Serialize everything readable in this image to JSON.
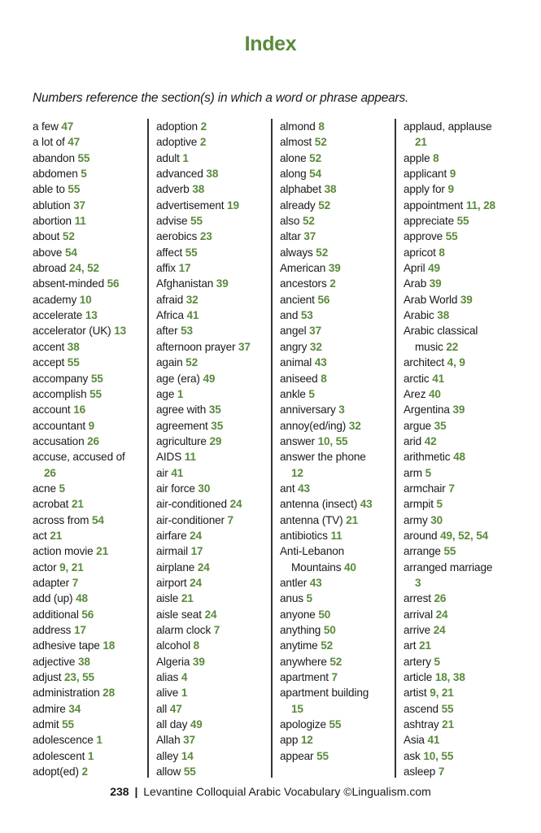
{
  "page": {
    "title": "Index",
    "subtitle": "Numbers reference the section(s) in which a word or phrase appears.",
    "footer": {
      "page_number": "238",
      "separator": "|",
      "text": "Levantine Colloquial Arabic Vocabulary ©Lingualism.com"
    },
    "accent_color": "#5a8a3c"
  },
  "columns": [
    [
      {
        "term": "a few",
        "refs": "47"
      },
      {
        "term": "a lot of",
        "refs": "47"
      },
      {
        "term": "abandon",
        "refs": "55"
      },
      {
        "term": "abdomen",
        "refs": "5"
      },
      {
        "term": "able to",
        "refs": "55"
      },
      {
        "term": "ablution",
        "refs": "37"
      },
      {
        "term": "abortion",
        "refs": "11"
      },
      {
        "term": "about",
        "refs": "52"
      },
      {
        "term": "above",
        "refs": "54"
      },
      {
        "term": "abroad",
        "refs": "24, 52"
      },
      {
        "term": "absent-minded",
        "refs": "56"
      },
      {
        "term": "academy",
        "refs": "10"
      },
      {
        "term": "accelerate",
        "refs": "13"
      },
      {
        "term": "accelerator (UK)",
        "refs": "13"
      },
      {
        "term": "accent",
        "refs": "38"
      },
      {
        "term": "accept",
        "refs": "55"
      },
      {
        "term": "accompany",
        "refs": "55"
      },
      {
        "term": "accomplish",
        "refs": "55"
      },
      {
        "term": "account",
        "refs": "16"
      },
      {
        "term": "accountant",
        "refs": "9"
      },
      {
        "term": "accusation",
        "refs": "26"
      },
      {
        "term": "accuse, accused of",
        "refs": "26",
        "wrap": true
      },
      {
        "term": "acne",
        "refs": "5"
      },
      {
        "term": "acrobat",
        "refs": "21"
      },
      {
        "term": "across from",
        "refs": "54"
      },
      {
        "term": "act",
        "refs": "21"
      },
      {
        "term": "action movie",
        "refs": "21"
      },
      {
        "term": "actor",
        "refs": "9, 21"
      },
      {
        "term": "adapter",
        "refs": "7"
      },
      {
        "term": "add (up)",
        "refs": "48"
      },
      {
        "term": "additional",
        "refs": "56"
      },
      {
        "term": "address",
        "refs": "17"
      },
      {
        "term": "adhesive tape",
        "refs": "18"
      },
      {
        "term": "adjective",
        "refs": "38"
      },
      {
        "term": "adjust",
        "refs": "23, 55"
      },
      {
        "term": "administration",
        "refs": "28"
      },
      {
        "term": "admire",
        "refs": "34"
      },
      {
        "term": "admit",
        "refs": "55"
      },
      {
        "term": "adolescence",
        "refs": "1"
      },
      {
        "term": "adolescent",
        "refs": "1"
      },
      {
        "term": "adopt(ed)",
        "refs": "2"
      }
    ],
    [
      {
        "term": "adoption",
        "refs": "2"
      },
      {
        "term": "adoptive",
        "refs": "2"
      },
      {
        "term": "adult",
        "refs": "1"
      },
      {
        "term": "advanced",
        "refs": "38"
      },
      {
        "term": "adverb",
        "refs": "38"
      },
      {
        "term": "advertisement",
        "refs": "19"
      },
      {
        "term": "advise",
        "refs": "55"
      },
      {
        "term": "aerobics",
        "refs": "23"
      },
      {
        "term": "affect",
        "refs": "55"
      },
      {
        "term": "affix",
        "refs": "17"
      },
      {
        "term": "Afghanistan",
        "refs": "39"
      },
      {
        "term": "afraid",
        "refs": "32"
      },
      {
        "term": "Africa",
        "refs": "41"
      },
      {
        "term": "after",
        "refs": "53"
      },
      {
        "term": "afternoon prayer",
        "refs": "37"
      },
      {
        "term": "again",
        "refs": "52"
      },
      {
        "term": "age (era)",
        "refs": "49"
      },
      {
        "term": "age",
        "refs": "1"
      },
      {
        "term": "agree with",
        "refs": "35"
      },
      {
        "term": "agreement",
        "refs": "35"
      },
      {
        "term": "agriculture",
        "refs": "29"
      },
      {
        "term": "AIDS",
        "refs": "11"
      },
      {
        "term": "air",
        "refs": "41"
      },
      {
        "term": "air force",
        "refs": "30"
      },
      {
        "term": "air-conditioned",
        "refs": "24"
      },
      {
        "term": "air-conditioner",
        "refs": "7"
      },
      {
        "term": "airfare",
        "refs": "24"
      },
      {
        "term": "airmail",
        "refs": "17"
      },
      {
        "term": "airplane",
        "refs": "24"
      },
      {
        "term": "airport",
        "refs": "24"
      },
      {
        "term": "aisle",
        "refs": "21"
      },
      {
        "term": "aisle seat",
        "refs": "24"
      },
      {
        "term": "alarm clock",
        "refs": "7"
      },
      {
        "term": "alcohol",
        "refs": "8"
      },
      {
        "term": "Algeria",
        "refs": "39"
      },
      {
        "term": "alias",
        "refs": "4"
      },
      {
        "term": "alive",
        "refs": "1"
      },
      {
        "term": "all",
        "refs": "47"
      },
      {
        "term": "all day",
        "refs": "49"
      },
      {
        "term": "Allah",
        "refs": "37"
      },
      {
        "term": "alley",
        "refs": "14"
      },
      {
        "term": "allow",
        "refs": "55"
      }
    ],
    [
      {
        "term": "almond",
        "refs": "8"
      },
      {
        "term": "almost",
        "refs": "52"
      },
      {
        "term": "alone",
        "refs": "52"
      },
      {
        "term": "along",
        "refs": "54"
      },
      {
        "term": "alphabet",
        "refs": "38"
      },
      {
        "term": "already",
        "refs": "52"
      },
      {
        "term": "also",
        "refs": "52"
      },
      {
        "term": "altar",
        "refs": "37"
      },
      {
        "term": "always",
        "refs": "52"
      },
      {
        "term": "American",
        "refs": "39"
      },
      {
        "term": "ancestors",
        "refs": "2"
      },
      {
        "term": "ancient",
        "refs": "56"
      },
      {
        "term": "and",
        "refs": "53"
      },
      {
        "term": "angel",
        "refs": "37"
      },
      {
        "term": "angry",
        "refs": "32"
      },
      {
        "term": "animal",
        "refs": "43"
      },
      {
        "term": "aniseed",
        "refs": "8"
      },
      {
        "term": "ankle",
        "refs": "5"
      },
      {
        "term": "anniversary",
        "refs": "3"
      },
      {
        "term": "annoy(ed/ing)",
        "refs": "32"
      },
      {
        "term": "answer",
        "refs": "10, 55"
      },
      {
        "term": "answer the phone",
        "refs": "12",
        "wrap": true
      },
      {
        "term": "ant",
        "refs": "43"
      },
      {
        "term": "antenna (insect)",
        "refs": "43"
      },
      {
        "term": "antenna (TV)",
        "refs": "21"
      },
      {
        "term": "antibiotics",
        "refs": "11"
      },
      {
        "term": "Anti-Lebanon",
        "term2": "Mountains",
        "refs": "40",
        "wrap": true
      },
      {
        "term": "antler",
        "refs": "43"
      },
      {
        "term": "anus",
        "refs": "5"
      },
      {
        "term": "anyone",
        "refs": "50"
      },
      {
        "term": "anything",
        "refs": "50"
      },
      {
        "term": "anytime",
        "refs": "52"
      },
      {
        "term": "anywhere",
        "refs": "52"
      },
      {
        "term": "apartment",
        "refs": "7"
      },
      {
        "term": "apartment building",
        "refs": "15",
        "wrap": true
      },
      {
        "term": "apologize",
        "refs": "55"
      },
      {
        "term": "app",
        "refs": "12"
      },
      {
        "term": "appear",
        "refs": "55"
      }
    ],
    [
      {
        "term": "applaud, applause",
        "refs": "21",
        "wrap": true
      },
      {
        "term": "apple",
        "refs": "8"
      },
      {
        "term": "applicant",
        "refs": "9"
      },
      {
        "term": "apply for",
        "refs": "9"
      },
      {
        "term": "appointment",
        "refs": "11, 28"
      },
      {
        "term": "appreciate",
        "refs": "55"
      },
      {
        "term": "approve",
        "refs": "55"
      },
      {
        "term": "apricot",
        "refs": "8"
      },
      {
        "term": "April",
        "refs": "49"
      },
      {
        "term": "Arab",
        "refs": "39"
      },
      {
        "term": "Arab World",
        "refs": "39"
      },
      {
        "term": "Arabic",
        "refs": "38"
      },
      {
        "term": "Arabic classical",
        "term2": "music",
        "refs": "22",
        "wrap": true
      },
      {
        "term": "architect",
        "refs": "4, 9"
      },
      {
        "term": "arctic",
        "refs": "41"
      },
      {
        "term": "Arez",
        "refs": "40"
      },
      {
        "term": "Argentina",
        "refs": "39"
      },
      {
        "term": "argue",
        "refs": "35"
      },
      {
        "term": "arid",
        "refs": "42"
      },
      {
        "term": "arithmetic",
        "refs": "48"
      },
      {
        "term": "arm",
        "refs": "5"
      },
      {
        "term": "armchair",
        "refs": "7"
      },
      {
        "term": "armpit",
        "refs": "5"
      },
      {
        "term": "army",
        "refs": "30"
      },
      {
        "term": "around",
        "refs": "49, 52, 54"
      },
      {
        "term": "arrange",
        "refs": "55"
      },
      {
        "term": "arranged marriage",
        "refs": "3",
        "wrap": true
      },
      {
        "term": "arrest",
        "refs": "26"
      },
      {
        "term": "arrival",
        "refs": "24"
      },
      {
        "term": "arrive",
        "refs": "24"
      },
      {
        "term": "art",
        "refs": "21"
      },
      {
        "term": "artery",
        "refs": "5"
      },
      {
        "term": "article",
        "refs": "18, 38"
      },
      {
        "term": "artist",
        "refs": "9, 21"
      },
      {
        "term": "ascend",
        "refs": "55"
      },
      {
        "term": "ashtray",
        "refs": "21"
      },
      {
        "term": "Asia",
        "refs": "41"
      },
      {
        "term": "ask",
        "refs": "10, 55"
      },
      {
        "term": "asleep",
        "refs": "7"
      }
    ]
  ]
}
